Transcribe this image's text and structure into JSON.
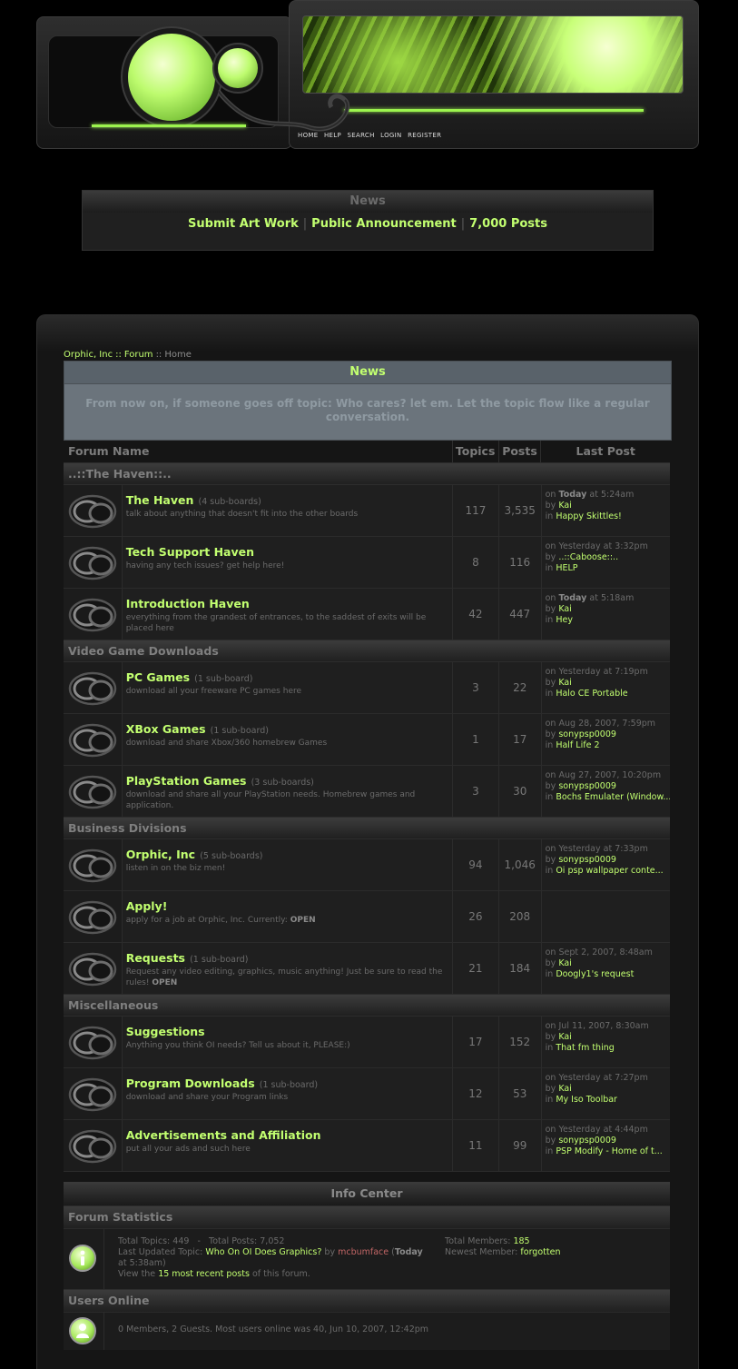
{
  "topnav": [
    "HOME",
    "HELP",
    "SEARCH",
    "LOGIN",
    "REGISTER"
  ],
  "news_box": {
    "title": "News",
    "links": [
      "Submit Art Work",
      "Public Announcement",
      "7,000 Posts"
    ],
    "separator": "|"
  },
  "breadcrumb": {
    "site": "Orphic, Inc",
    "forum": "Forum",
    "current": "Home",
    "separator": "::"
  },
  "board_news": {
    "title": "News",
    "text": "From now on, if someone goes off topic: Who cares? let em. Let the topic flow like a regular conversation."
  },
  "columns": {
    "name": "Forum Name",
    "topics": "Topics",
    "posts": "Posts",
    "last": "Last Post"
  },
  "categories": [
    {
      "name": "..::The Haven::..",
      "boards": [
        {
          "name": "The Haven",
          "sub": "(4 sub-boards)",
          "desc": "talk about anything that doesn't fit into the other boards",
          "topics": "117",
          "posts": "3,535",
          "last_on": "on",
          "last_date": "Today",
          "last_time": "at 5:24am",
          "last_by": "Kai",
          "last_in": "Happy Skittles!"
        },
        {
          "name": "Tech Support Haven",
          "sub": "",
          "desc": "having any tech issues? get help here!",
          "topics": "8",
          "posts": "116",
          "last_on": "on",
          "last_date": "",
          "last_time": "Yesterday at 3:32pm",
          "last_by": "..::Caboose::..",
          "last_in": "HELP"
        },
        {
          "name": "Introduction Haven",
          "sub": "",
          "desc": "everything from the grandest of entrances, to the saddest of exits will be placed here",
          "topics": "42",
          "posts": "447",
          "last_on": "on",
          "last_date": "Today",
          "last_time": "at 5:18am",
          "last_by": "Kai",
          "last_in": "Hey"
        }
      ]
    },
    {
      "name": "Video Game Downloads",
      "boards": [
        {
          "name": "PC Games",
          "sub": "(1 sub-board)",
          "desc": "download all your freeware PC games here",
          "topics": "3",
          "posts": "22",
          "last_on": "on",
          "last_date": "",
          "last_time": "Yesterday at 7:19pm",
          "last_by": "Kai",
          "last_in": "Halo CE Portable"
        },
        {
          "name": "XBox Games",
          "sub": "(1 sub-board)",
          "desc": "download and share Xbox/360 homebrew Games",
          "topics": "1",
          "posts": "17",
          "last_on": "on",
          "last_date": "",
          "last_time": "Aug 28, 2007, 7:59pm",
          "last_by": "sonypsp0009",
          "last_in": "Half Life 2"
        },
        {
          "name": "PlayStation Games",
          "sub": "(3 sub-boards)",
          "desc": "download and share all your PlayStation needs. Homebrew games and application.",
          "topics": "3",
          "posts": "30",
          "last_on": "on",
          "last_date": "",
          "last_time": "Aug 27, 2007, 10:20pm",
          "last_by": "sonypsp0009",
          "last_in": "Bochs Emulater (Window..."
        }
      ]
    },
    {
      "name": "Business Divisions",
      "boards": [
        {
          "name": "Orphic, Inc",
          "sub": "(5 sub-boards)",
          "desc": "listen in on the biz men!",
          "topics": "94",
          "posts": "1,046",
          "last_on": "on",
          "last_date": "",
          "last_time": "Yesterday at 7:33pm",
          "last_by": "sonypsp0009",
          "last_in": "Oi psp wallpaper conte..."
        },
        {
          "name": "Apply!",
          "sub": "",
          "desc": "apply for a job at Orphic, Inc. Currently:",
          "desc_bold": "OPEN",
          "topics": "26",
          "posts": "208",
          "last_on": "",
          "last_date": "",
          "last_time": "",
          "last_by": "",
          "last_in": ""
        },
        {
          "name": "Requests",
          "sub": "(1 sub-board)",
          "desc": "Request any video editing, graphics, music anything! Just be sure to read the rules!",
          "desc_bold": "OPEN",
          "topics": "21",
          "posts": "184",
          "last_on": "on",
          "last_date": "",
          "last_time": "Sept 2, 2007, 8:48am",
          "last_by": "Kai",
          "last_in": "Doogly1's request"
        }
      ]
    },
    {
      "name": "Miscellaneous",
      "boards": [
        {
          "name": "Suggestions",
          "sub": "",
          "desc": "Anything you think OI needs? Tell us about it, PLEASE:)",
          "topics": "17",
          "posts": "152",
          "last_on": "on",
          "last_date": "",
          "last_time": "Jul 11, 2007, 8:30am",
          "last_by": "Kai",
          "last_in": "That fm thing"
        },
        {
          "name": "Program Downloads",
          "sub": "(1 sub-board)",
          "desc": "download and share your Program links",
          "topics": "12",
          "posts": "53",
          "last_on": "on",
          "last_date": "",
          "last_time": "Yesterday at 7:27pm",
          "last_by": "Kai",
          "last_in": "My Iso Toolbar"
        },
        {
          "name": "Advertisements and Affiliation",
          "sub": "",
          "desc": "put all your ads and such here",
          "topics": "11",
          "posts": "99",
          "last_on": "on",
          "last_date": "",
          "last_time": "Yesterday at 4:44pm",
          "last_by": "sonypsp0009",
          "last_in": "PSP Modify - Home of t..."
        }
      ]
    }
  ],
  "info_center": {
    "title": "Info Center",
    "stats_title": "Forum Statistics",
    "total_topics_label": "Total Topics:",
    "total_topics": "449",
    "dash": "-",
    "total_posts_label": "Total Posts:",
    "total_posts": "7,052",
    "last_updated_label": "Last Updated Topic:",
    "last_updated_topic": "Who On OI Does Graphics?",
    "by": "by",
    "last_updated_by": "mcbumface",
    "last_updated_when_open": "(",
    "last_updated_when_bold": "Today",
    "last_updated_when": "at 5:38am)",
    "view_prefix": "View the",
    "view_link": "15 most recent posts",
    "view_suffix": "of this forum.",
    "total_members_label": "Total Members:",
    "total_members": "185",
    "newest_member_label": "Newest Member:",
    "newest_member": "forgotten",
    "online_title": "Users Online",
    "online_text": "0 Members, 2 Guests. Most users online was 40, Jun 10, 2007, 12:42pm"
  }
}
